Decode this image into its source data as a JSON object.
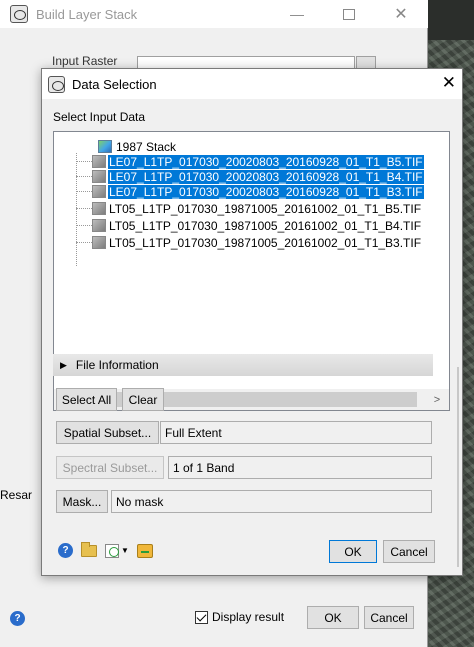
{
  "parent_window": {
    "title": "Build Layer Stack",
    "input_raster_label": "Input Raster",
    "resampling_label": "Resar",
    "display_result_label": "Display result",
    "ok_label": "OK",
    "cancel_label": "Cancel"
  },
  "dialog": {
    "title": "Data Selection",
    "select_input_label": "Select Input Data",
    "tree": {
      "root": "1987 Stack",
      "items": [
        {
          "label": "LE07_L1TP_017030_20020803_20160928_01_T1_B5.TIF",
          "selected": true
        },
        {
          "label": "LE07_L1TP_017030_20020803_20160928_01_T1_B4.TIF",
          "selected": true
        },
        {
          "label": "LE07_L1TP_017030_20020803_20160928_01_T1_B3.TIF",
          "selected": true
        },
        {
          "label": "LT05_L1TP_017030_19871005_20161002_01_T1_B5.TIF",
          "selected": false
        },
        {
          "label": "LT05_L1TP_017030_19871005_20161002_01_T1_B4.TIF",
          "selected": false
        },
        {
          "label": "LT05_L1TP_017030_19871005_20161002_01_T1_B3.TIF",
          "selected": false
        }
      ]
    },
    "file_information_label": "File Information",
    "select_all_label": "Select All",
    "clear_label": "Clear",
    "spatial_subset_label": "Spatial Subset...",
    "spatial_subset_value": "Full Extent",
    "spectral_subset_label": "Spectral Subset...",
    "spectral_subset_value": "1 of 1 Band",
    "mask_label": "Mask...",
    "mask_value": "No mask",
    "ok_label": "OK",
    "cancel_label": "Cancel"
  },
  "colors": {
    "selection": "#0078d7",
    "dialog_bg": "#f0f0f0",
    "help_icon": "#2a6ccb"
  }
}
